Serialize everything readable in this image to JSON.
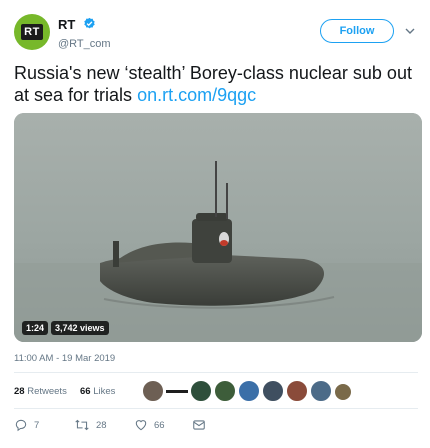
{
  "account": {
    "avatar_text": "RT",
    "name": "RT",
    "handle": "@RT_com",
    "follow_label": "Follow"
  },
  "tweet": {
    "text": "Russia's new ‘stealth’ Borey-class nuclear sub out at sea for trials",
    "link": "on.rt.com/9qgc"
  },
  "media": {
    "duration": "1:24",
    "views": "3,742 views"
  },
  "timestamp": "11:00 AM - 19 Mar 2019",
  "stats": {
    "retweets_count": "28",
    "retweets_label": "Retweets",
    "likes_count": "66",
    "likes_label": "Likes"
  },
  "actions": {
    "reply_count": "7",
    "retweet_count": "28",
    "like_count": "66"
  },
  "colors": {
    "accent": "#1da1f2",
    "avatar_bg": "#77b82a",
    "muted": "#657786"
  },
  "icons": [
    "verified-badge-icon",
    "chevron-down-icon",
    "reply-icon",
    "retweet-icon",
    "heart-icon",
    "direct-message-icon"
  ]
}
